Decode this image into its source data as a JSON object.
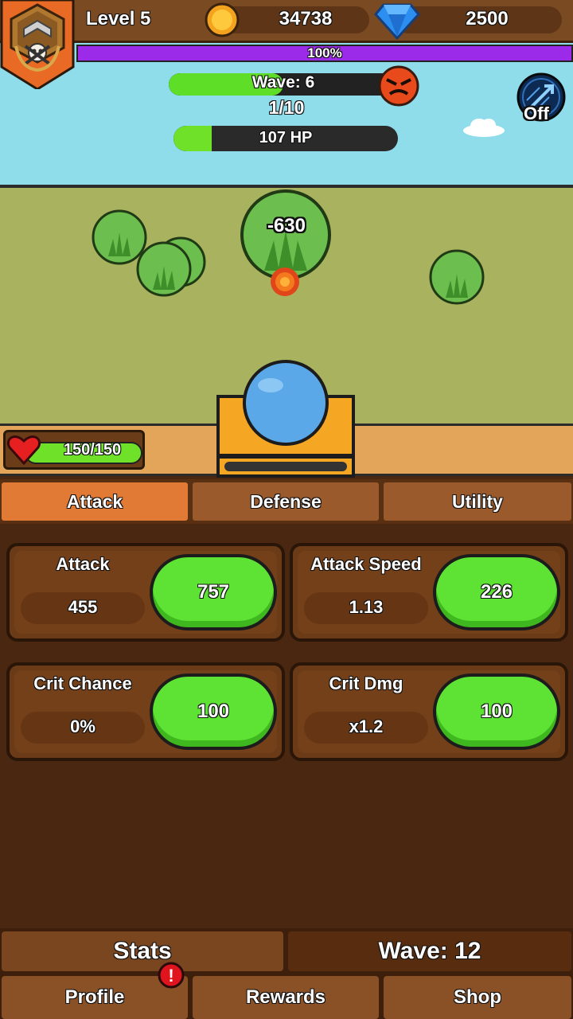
{
  "header": {
    "level_label": "Level 5",
    "coins": "34738",
    "gems": "2500",
    "xp_label": "100%",
    "xp_progress": 1.0
  },
  "wave": {
    "label": "Wave: 6",
    "progress_text": "1/10",
    "bar_progress": 0.5
  },
  "enemy": {
    "hp_label": "107 HP",
    "hp_progress": 0.17
  },
  "auto_toggle": {
    "label": "Off"
  },
  "battle": {
    "damage_popup": "-630"
  },
  "player": {
    "hp_label": "150/150",
    "hp_progress": 1.0
  },
  "tabs": [
    {
      "label": "Attack",
      "active": true
    },
    {
      "label": "Defense",
      "active": false
    },
    {
      "label": "Utility",
      "active": false
    }
  ],
  "stats": [
    {
      "name": "Attack",
      "value": "455",
      "cost": "757"
    },
    {
      "name": "Attack Speed",
      "value": "1.13",
      "cost": "226"
    },
    {
      "name": "Crit Chance",
      "value": "0%",
      "cost": "100"
    },
    {
      "name": "Crit Dmg",
      "value": "x1.2",
      "cost": "100"
    }
  ],
  "footer": {
    "stats_label": "Stats",
    "wave_label": "Wave: 12",
    "nav": [
      {
        "label": "Profile",
        "alert": "!"
      },
      {
        "label": "Rewards"
      },
      {
        "label": "Shop"
      }
    ]
  },
  "colors": {
    "xp_bar": "#9b2be8",
    "progress_green": "#5fde28",
    "upgrade_green": "#5ee233",
    "active_tab": "#e07a35",
    "panel_brown": "#6b3a16"
  }
}
